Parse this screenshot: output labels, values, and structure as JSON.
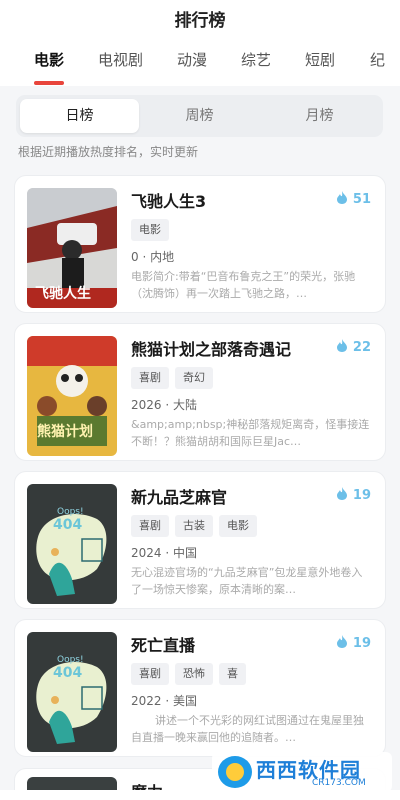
{
  "header": {
    "title": "排行榜"
  },
  "category_tabs": [
    "电影",
    "电视剧",
    "动漫",
    "综艺",
    "短剧",
    "纪"
  ],
  "period_tabs": [
    "日榜",
    "周榜",
    "月榜"
  ],
  "hint": "根据近期播放热度排名，实时更新",
  "items": [
    {
      "title": "飞驰人生3",
      "heat": "51",
      "tags": [
        "电影"
      ],
      "meta": "0 · 内地",
      "desc": "电影简介:带着“巴音布鲁克之王”的荣光，张驰（沈腾饰）再一次踏上飞驰之路，…"
    },
    {
      "title": "熊猫计划之部落奇遇记",
      "heat": "22",
      "tags": [
        "喜剧",
        "奇幻"
      ],
      "meta": "2026 · 大陆",
      "desc": "&amp;amp;nbsp;神秘部落规矩离奇，怪事接连不断！？熊猫胡胡和国际巨星Jac…"
    },
    {
      "title": "新九品芝麻官",
      "heat": "19",
      "tags": [
        "喜剧",
        "古装",
        "电影"
      ],
      "meta": "2024 · 中国",
      "desc": "无心混迹官场的“九品芝麻官”包龙星意外地卷入了一场惊天惨案，原本清晰的案…"
    },
    {
      "title": "死亡直播",
      "heat": "19",
      "tags": [
        "喜剧",
        "恐怖",
        "喜"
      ],
      "meta": "2022 · 美国",
      "desc": "讲述一个不光彩的网红试图通过在鬼屋里独自直播一晚来赢回他的追随者。…"
    }
  ],
  "next_item_title": "魔力",
  "poster_texts": {
    "p1": "飞驰人生",
    "p2": "熊猫计划",
    "oops": "Oops!",
    "code": "404"
  },
  "watermark": {
    "main": "西西软件园",
    "sub": "CR173.COM"
  },
  "colors": {
    "accent": "#e8453c",
    "heat": "#6cbfe8"
  }
}
